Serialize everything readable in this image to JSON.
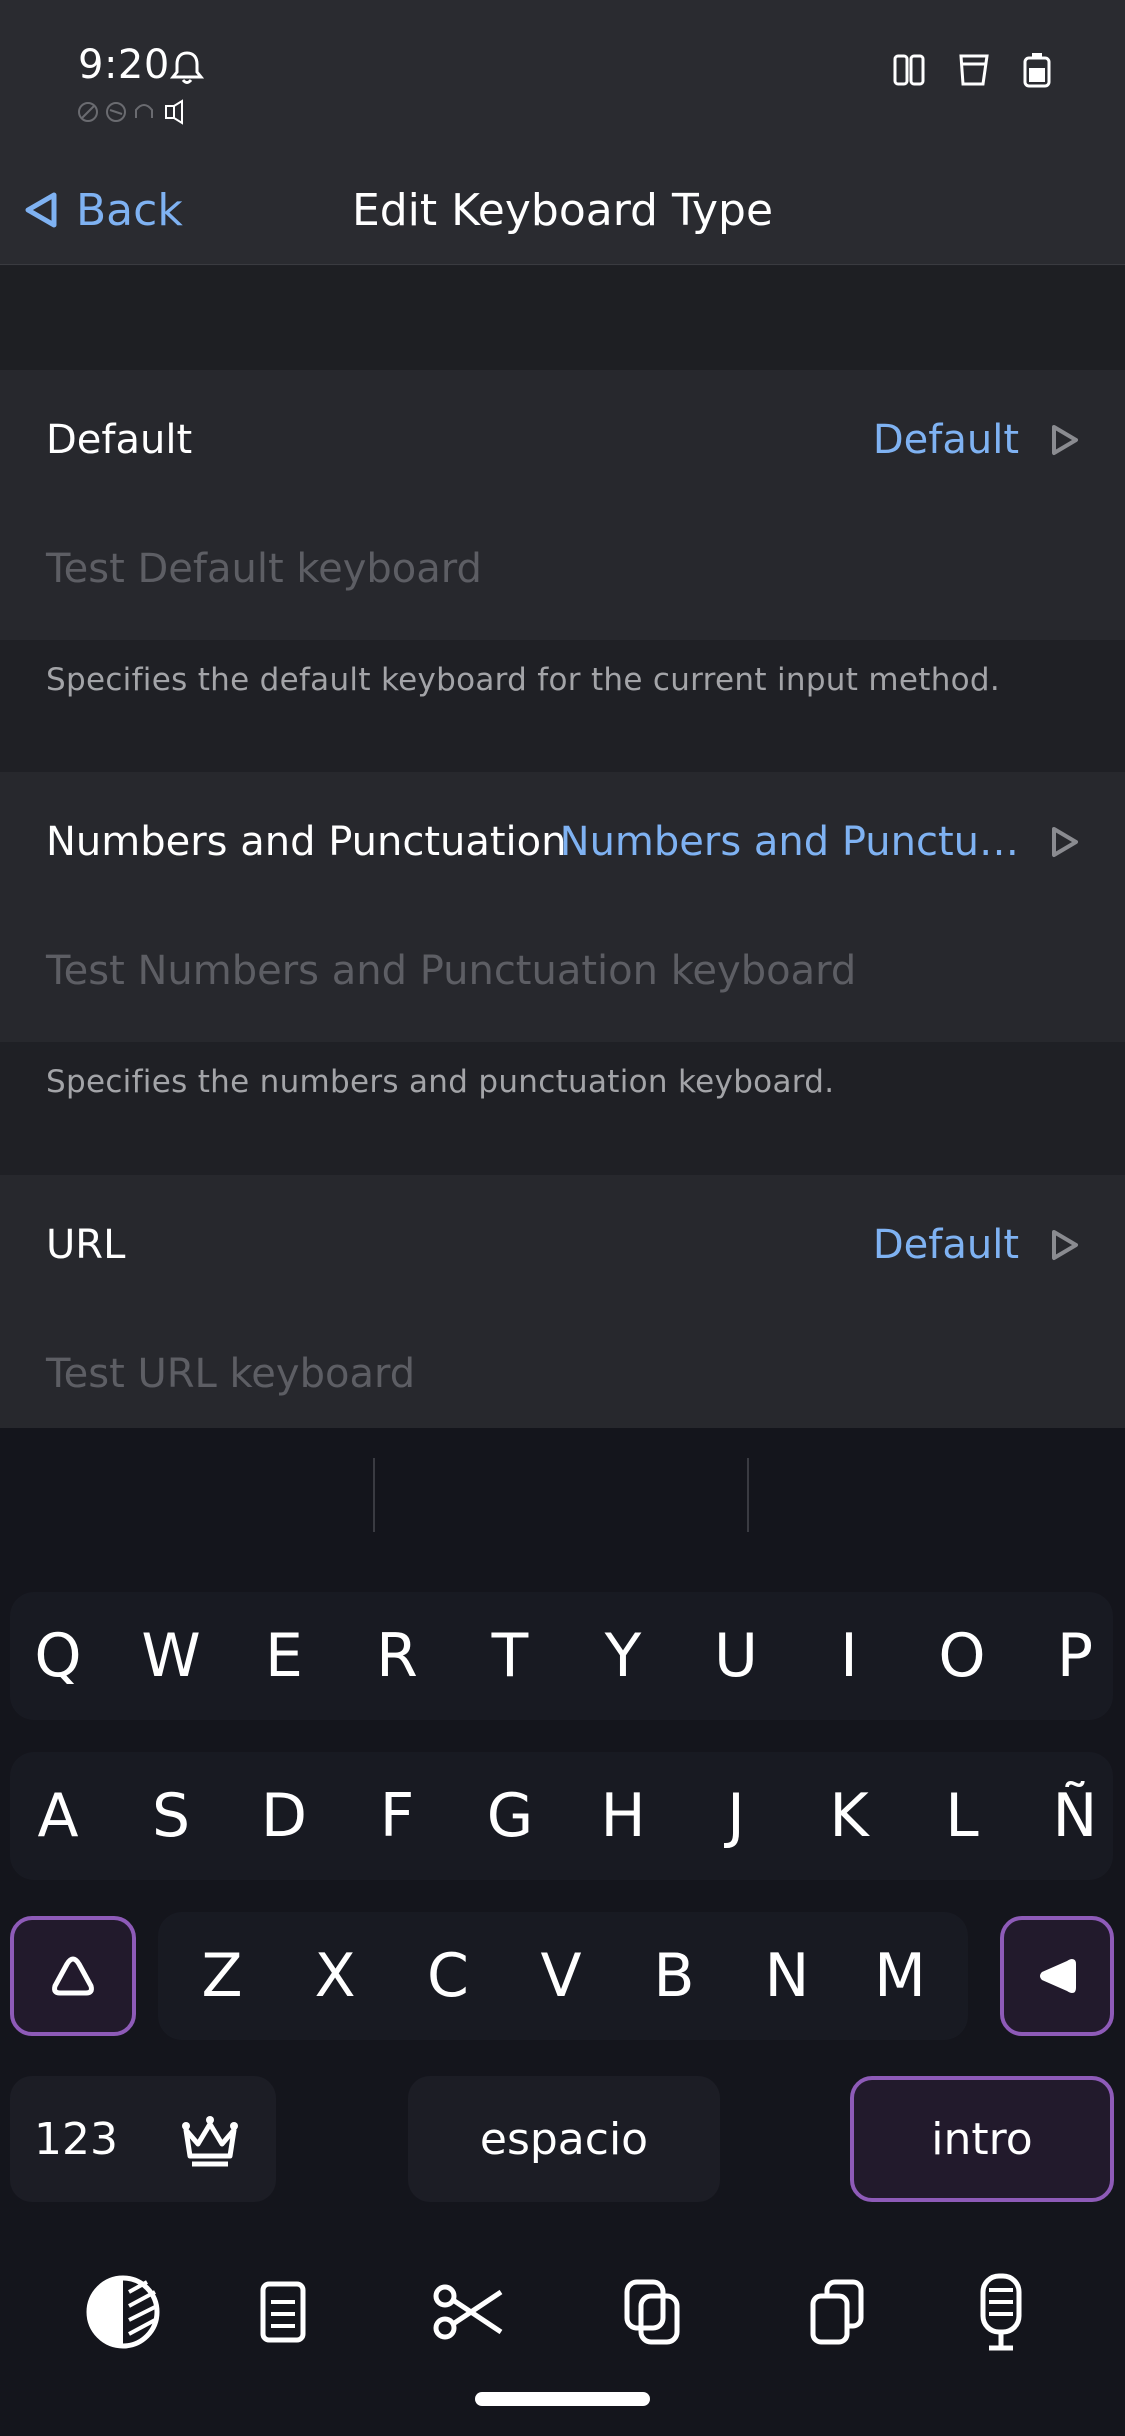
{
  "status": {
    "time": "9:20"
  },
  "nav": {
    "back_label": "Back",
    "title": "Edit Keyboard Type"
  },
  "sections": [
    {
      "label": "Default",
      "value": "Default",
      "test_placeholder": "Test Default keyboard",
      "description": "Specifies the default keyboard for the current input method."
    },
    {
      "label": "Numbers and Punctuation",
      "value": "Numbers and Punctu…",
      "test_placeholder": "Test Numbers and Punctuation keyboard",
      "description": "Specifies the numbers and punctuation keyboard."
    },
    {
      "label": "URL",
      "value": "Default",
      "test_placeholder": "Test URL keyboard"
    }
  ],
  "keyboard": {
    "row1": [
      "Q",
      "W",
      "E",
      "R",
      "T",
      "Y",
      "U",
      "I",
      "O",
      "P"
    ],
    "row2": [
      "A",
      "S",
      "D",
      "F",
      "G",
      "H",
      "J",
      "K",
      "L",
      "Ñ"
    ],
    "row3": [
      "Z",
      "X",
      "C",
      "V",
      "B",
      "N",
      "M"
    ],
    "numbers_key": "123",
    "space_key": "espacio",
    "enter_key": "intro"
  },
  "icons": {
    "back": "back-triangle-icon",
    "chevron": "chevron-right-icon",
    "shift": "shift-icon",
    "delete": "backspace-icon",
    "crown": "crown-icon",
    "toolbar": [
      "theme-icon",
      "clipboard-icon",
      "cut-icon",
      "copy-icon",
      "paste-icon",
      "microphone-icon"
    ]
  },
  "colors": {
    "accent": "#7fb2f2",
    "purple_border": "#8e5bb8",
    "background": "#1f2025"
  }
}
